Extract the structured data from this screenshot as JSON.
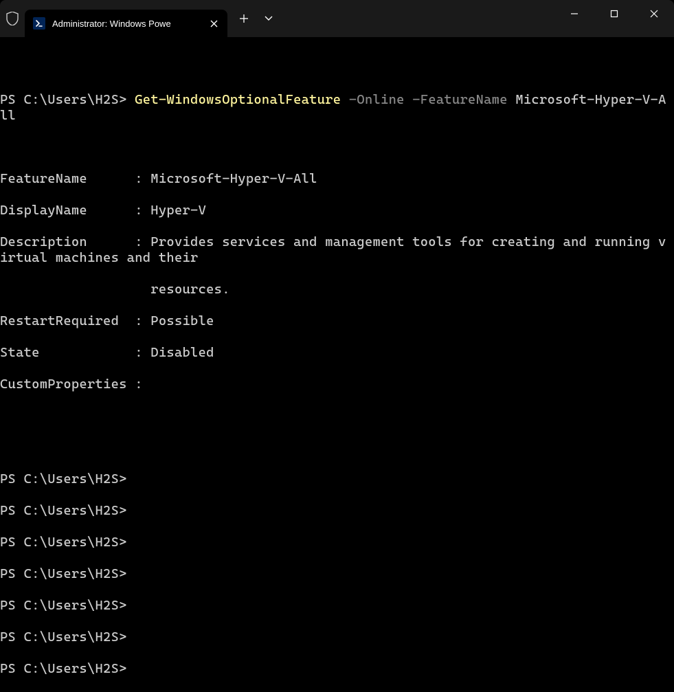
{
  "titlebar": {
    "tab_title": "Administrator: Windows Powe",
    "close_symbol": "✕",
    "new_tab_symbol": "+",
    "dropdown_symbol": "⌄",
    "minimize_symbol": "—",
    "maximize_symbol": "☐",
    "close_window_symbol": "✕"
  },
  "terminal": {
    "prompt": "PS C:\\Users\\H2S>",
    "command": {
      "cmdlet": "Get-WindowsOptionalFeature",
      "param1": "-Online",
      "param2": "-FeatureName",
      "arg": "Microsoft-Hyper-V-All"
    },
    "output": {
      "l1": "FeatureName      : Microsoft-Hyper-V-All",
      "l2": "DisplayName      : Hyper-V",
      "l3": "Description      : Provides services and management tools for creating and running virtual machines and their",
      "l4": "                   resources.",
      "l5": "RestartRequired  : Possible",
      "l6": "State            : Disabled",
      "l7": "CustomProperties :"
    },
    "empty_prompts": [
      "PS C:\\Users\\H2S>",
      "PS C:\\Users\\H2S>",
      "PS C:\\Users\\H2S>",
      "PS C:\\Users\\H2S>",
      "PS C:\\Users\\H2S>",
      "PS C:\\Users\\H2S>",
      "PS C:\\Users\\H2S>"
    ]
  }
}
